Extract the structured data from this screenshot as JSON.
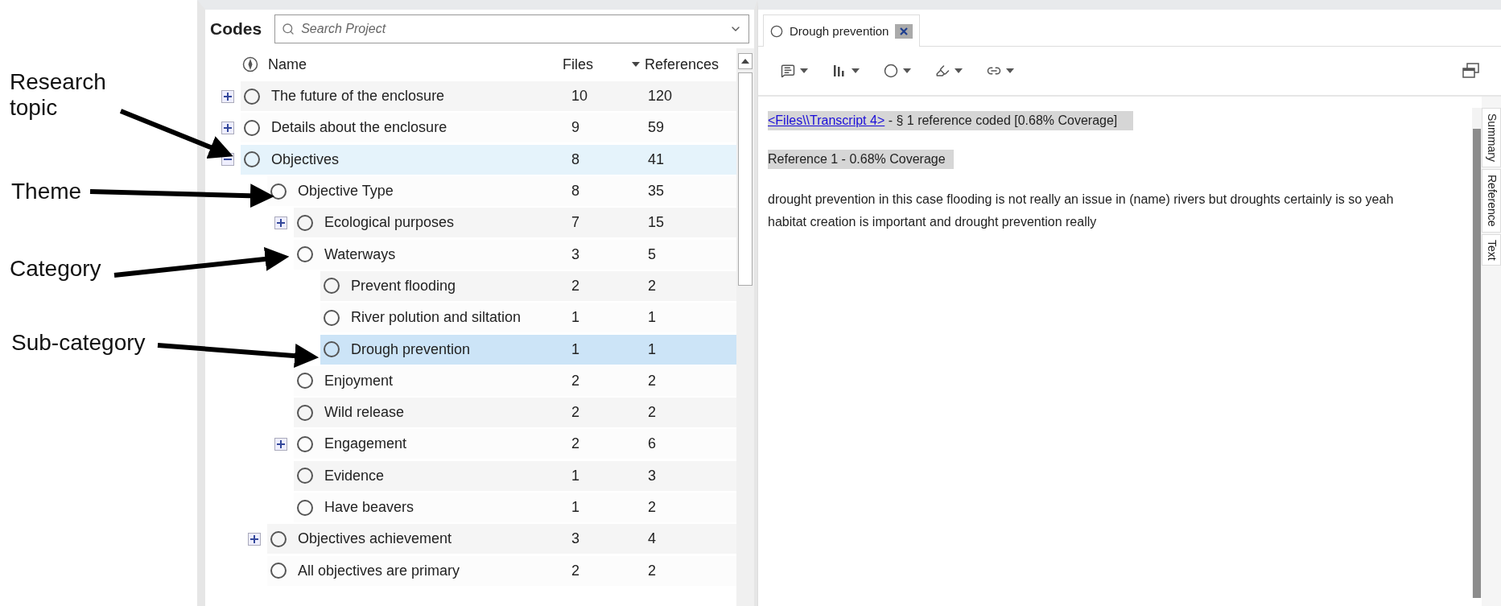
{
  "annotations": [
    {
      "text": "Research topic"
    },
    {
      "text": "Theme"
    },
    {
      "text": "Category"
    },
    {
      "text": "Sub-category"
    }
  ],
  "codes_panel": {
    "title": "Codes",
    "search": {
      "placeholder": "Search Project"
    },
    "columns": [
      {
        "label": "Name",
        "sorted": false
      },
      {
        "label": "Files",
        "sorted": false
      },
      {
        "label": "References",
        "sorted": true
      }
    ],
    "rows": [
      {
        "name": "The future of the enclosure",
        "files": "10",
        "references": "120",
        "expanded": false,
        "selected": false,
        "hovered": false
      },
      {
        "name": "Details about the enclosure",
        "files": "9",
        "references": "59",
        "expanded": false,
        "selected": false,
        "hovered": false
      },
      {
        "name": "Objectives",
        "files": "8",
        "references": "41",
        "expanded": true,
        "selected": false,
        "hovered": true,
        "children": [
          {
            "name": "Objective Type",
            "files": "8",
            "references": "35",
            "selected": false,
            "hovered": false,
            "children": [
              {
                "name": "Ecological purposes",
                "files": "7",
                "references": "15",
                "expanded": false,
                "selected": false,
                "hovered": false
              },
              {
                "name": "Waterways",
                "files": "3",
                "references": "5",
                "selected": false,
                "hovered": false,
                "children": [
                  {
                    "name": "Prevent flooding",
                    "files": "2",
                    "references": "2",
                    "selected": false,
                    "hovered": false
                  },
                  {
                    "name": "River polution and siltation",
                    "files": "1",
                    "references": "1",
                    "selected": false,
                    "hovered": false
                  },
                  {
                    "name": "Drough prevention",
                    "files": "1",
                    "references": "1",
                    "selected": true,
                    "hovered": false
                  }
                ]
              },
              {
                "name": "Enjoyment",
                "files": "2",
                "references": "2",
                "selected": false,
                "hovered": false
              },
              {
                "name": "Wild release",
                "files": "2",
                "references": "2",
                "selected": false,
                "hovered": false
              },
              {
                "name": "Engagement",
                "files": "2",
                "references": "6",
                "expanded": false,
                "selected": false,
                "hovered": false
              },
              {
                "name": "Evidence",
                "files": "1",
                "references": "3",
                "selected": false,
                "hovered": false
              },
              {
                "name": "Have beavers",
                "files": "1",
                "references": "2",
                "selected": false,
                "hovered": false
              }
            ]
          },
          {
            "name": "Objectives achievement",
            "files": "3",
            "references": "4",
            "expanded": false,
            "selected": false,
            "hovered": false
          },
          {
            "name": "All objectives are primary",
            "files": "2",
            "references": "2",
            "selected": false,
            "hovered": false
          }
        ]
      }
    ]
  },
  "detail_panel": {
    "tab": {
      "label": "Drough prevention",
      "selected": true
    },
    "header": {
      "link": "<Files\\\\Transcript 4>",
      "text": " - § 1 reference coded  [0.68% Coverage]"
    },
    "reference": "Reference 1 - 0.68% Coverage",
    "excerpt": "drought prevention in this case flooding is not really an issue in (name) rivers but droughts certainly is so yeah habitat creation is important and drought prevention really",
    "side_tabs": [
      {
        "label": "Summary"
      },
      {
        "label": "Reference"
      },
      {
        "label": "Text"
      }
    ]
  }
}
